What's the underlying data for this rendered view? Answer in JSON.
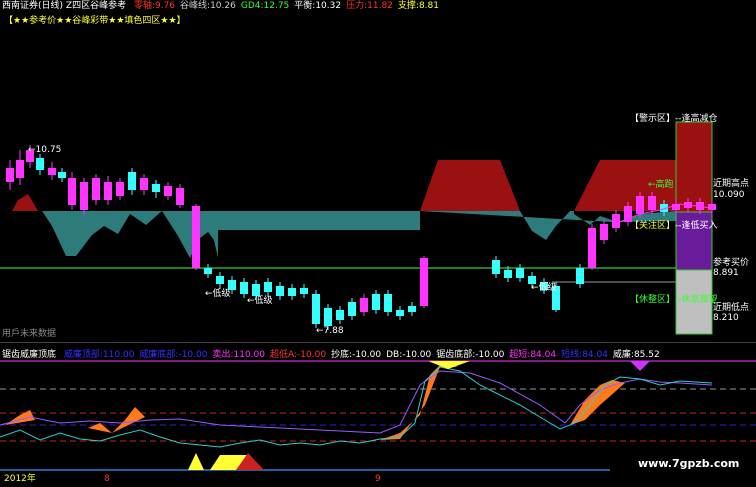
{
  "header": {
    "title": "西南证券(日线)",
    "indicator": "Z四区谷峰参考",
    "items": [
      {
        "label": "零轴:",
        "value": "9.76",
        "color": "#ff3333"
      },
      {
        "label": "谷峰线:",
        "value": "10.26",
        "color": "#cccccc"
      },
      {
        "label": "GD4:",
        "value": "12.75",
        "color": "#33ff33"
      },
      {
        "label": "平衡:",
        "value": "10.32",
        "color": "#ffffff"
      },
      {
        "label": "压力:",
        "value": "11.82",
        "color": "#ff3333"
      },
      {
        "label": "支撑:",
        "value": "8.81",
        "color": "#ffff33"
      }
    ],
    "banner": "【★★参考价★★谷峰彩带★★填色四区★★】"
  },
  "price_labels": {
    "high": "10.75",
    "low": "7.88",
    "low_level_1": "低级",
    "low_level_2": "低级",
    "low_level_3": "低级",
    "peak_rest": "高跑"
  },
  "zones": {
    "warning": "【警示区】",
    "warning_tip": "--逢高减仓",
    "attention": "【关注区】",
    "attention_tip": "--逢低买入",
    "rest": "【休整区】",
    "rest_tip": "--休息观望",
    "recent_high_label": "近期高点",
    "recent_high_value": "10.090",
    "ref_buy_label": "参考买价",
    "ref_buy_value": "8.891",
    "recent_low_label": "近期低点",
    "recent_low_value": "8.210"
  },
  "watermark": "用戶未来数据",
  "lower_header": {
    "title": "锯齿威廉顶底",
    "items": [
      {
        "label": "威廉顶部:",
        "value": "110.00",
        "color": "#3333ff"
      },
      {
        "label": "威廉底部:",
        "value": "-10.00",
        "color": "#3333ff"
      },
      {
        "label": "卖出:",
        "value": "110.00",
        "color": "#ff33ff"
      },
      {
        "label": "超低A:",
        "value": "-10.00",
        "color": "#ff3333"
      },
      {
        "label": "抄底:",
        "value": "-10.00",
        "color": "#ffffff"
      },
      {
        "label": "DB:",
        "value": "-10.00",
        "color": "#ffffff"
      },
      {
        "label": "锯齿底部:",
        "value": "-10.00",
        "color": "#ffffff"
      },
      {
        "label": "超短:",
        "value": "84.04",
        "color": "#ff33ff"
      },
      {
        "label": "短线:",
        "value": "84.04",
        "color": "#3333ff"
      },
      {
        "label": "威廉:",
        "value": "85.52",
        "color": "#ffffff"
      }
    ]
  },
  "x_axis": {
    "year": "2012年",
    "month_1": "8",
    "month_2": "9"
  },
  "site": "www.7gpzb.com",
  "colors": {
    "up": "#ff33ff",
    "down": "#33ffff",
    "teal_band": "#2e7b7b",
    "red_band": "#9b1111",
    "green_line": "#33cc33",
    "purple": "#6a1b9a",
    "orange": "#ff7a1a"
  }
}
